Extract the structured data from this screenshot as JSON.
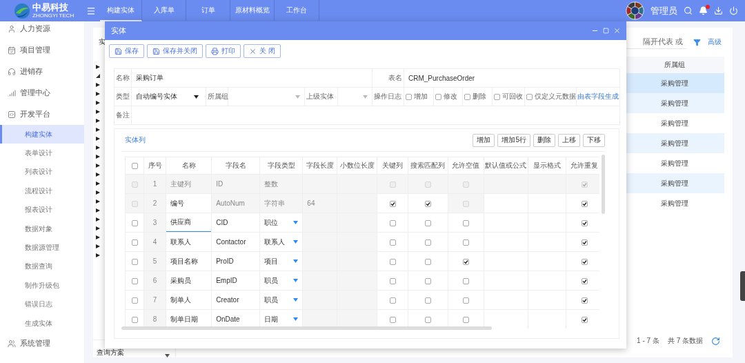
{
  "header": {
    "logo_title": "中易科技",
    "logo_subtitle": "ZHONGYI TECH",
    "tabs": [
      {
        "label": "构建实体",
        "selected": true
      },
      {
        "label": "入库单",
        "selected": false
      },
      {
        "label": "订单",
        "selected": false
      },
      {
        "label": "原材料概览",
        "selected": false
      },
      {
        "label": "工作台",
        "selected": false
      }
    ],
    "user": "管理员",
    "notification": true
  },
  "sidebar": {
    "items": [
      {
        "label": "人力资源"
      },
      {
        "label": "项目管理"
      },
      {
        "label": "进销存"
      },
      {
        "label": "管理中心"
      },
      {
        "label": "开发平台",
        "children": [
          {
            "label": "构建实体",
            "selected": true
          },
          {
            "label": "表单设计",
            "selected": false
          },
          {
            "label": "列表设计",
            "selected": false
          },
          {
            "label": "流程设计",
            "selected": false
          },
          {
            "label": "报表设计",
            "selected": false
          },
          {
            "label": "数据对象",
            "selected": false
          },
          {
            "label": "数据源管理",
            "selected": false
          },
          {
            "label": "数据查询",
            "selected": false
          },
          {
            "label": "制作升级包",
            "selected": false
          },
          {
            "label": "错误日志",
            "selected": false
          },
          {
            "label": "生成实体",
            "selected": false
          }
        ]
      },
      {
        "label": "系统管理"
      }
    ]
  },
  "background": {
    "panel_title": "实",
    "tree": [
      false,
      true,
      false,
      false,
      false,
      false,
      false,
      false,
      false,
      false,
      false,
      false,
      false,
      false,
      false,
      false,
      false,
      false,
      false,
      false,
      false,
      false
    ],
    "scheme": "查询方案",
    "search_text": "隔开代表 或",
    "advanced": "高级",
    "list_header": "所属组",
    "rows": [
      {
        "group": "采购管理",
        "selected": true
      },
      {
        "group": "采购管理",
        "selected": false
      },
      {
        "group": "采购管理",
        "selected": false
      },
      {
        "group": "采购管理",
        "selected": false
      },
      {
        "group": "采购管理",
        "selected": false
      },
      {
        "group": "采购管理",
        "selected": false
      },
      {
        "group": "采购管理",
        "selected": false
      }
    ],
    "range": "1 - 7 条",
    "total": "共 7 条数据"
  },
  "dialog": {
    "title": "实体",
    "toolbar": [
      {
        "kind": "save",
        "label": "保存"
      },
      {
        "kind": "save",
        "label": "保存并关闭"
      },
      {
        "kind": "print",
        "label": "打印"
      },
      {
        "kind": "close",
        "label": "关 闭"
      }
    ],
    "form": {
      "name_label": "名称",
      "name": "采购订单",
      "table_label": "表名",
      "table": "CRM_PurchaseOrder",
      "type_label": "类型",
      "type": "自动编号实体",
      "group_label": "所属组",
      "parent_label": "上级实体",
      "log_label": "操作日志",
      "log_options": [
        {
          "label": "增加",
          "checked": false
        },
        {
          "label": "修改",
          "checked": false
        },
        {
          "label": "删除",
          "checked": false
        },
        {
          "label": "可回收",
          "checked": false
        },
        {
          "label": "仅定义元数据",
          "checked": false
        }
      ],
      "generate_link": "由表字段生成",
      "remark_label": "备注"
    },
    "columns_title": "实体列",
    "column_actions": [
      "增加",
      "增加5行",
      "删除",
      "上移",
      "下移"
    ],
    "grid_header": [
      "序号",
      "名称",
      "字段名",
      "字段类型",
      "字段长度",
      "小数位长度",
      "关键列",
      "搜索匹配列",
      "允许空值",
      "默认值或公式",
      "显示格式",
      "允许重复"
    ],
    "grid_select_all": false,
    "rows": [
      {
        "index": "1",
        "name": "主键列",
        "field": "ID",
        "type": "整数",
        "locked": true,
        "fixed": true,
        "dropdown": false,
        "editing": false,
        "select": {
          "checked": false,
          "disabled": true
        },
        "key": {
          "checked": false,
          "disabled": true
        },
        "search": {
          "checked": false,
          "disabled": true
        },
        "nullable": {
          "checked": false,
          "disabled": true
        },
        "repeat": {
          "checked": true,
          "disabled": true
        }
      },
      {
        "index": "2",
        "name": "编号",
        "field": "AutoNum",
        "type": "字符串",
        "length": "64",
        "locked": false,
        "fixed": true,
        "dropdown": false,
        "editing": false,
        "select": {
          "checked": false,
          "disabled": true
        },
        "key": {
          "checked": true,
          "disabled": false
        },
        "search": {
          "checked": true,
          "disabled": false
        },
        "nullable": {
          "checked": false,
          "disabled": true
        },
        "repeat": {
          "checked": true,
          "disabled": false
        }
      },
      {
        "index": "3",
        "name": "供应商",
        "field": "CID",
        "type": "职位",
        "locked": false,
        "fixed": false,
        "dropdown": true,
        "editing": true,
        "select": {
          "checked": false,
          "disabled": false
        },
        "key": {
          "checked": false,
          "disabled": false
        },
        "search": {
          "checked": false,
          "disabled": false
        },
        "nullable": {
          "checked": false,
          "disabled": false
        },
        "repeat": {
          "checked": true,
          "disabled": false
        }
      },
      {
        "index": "4",
        "name": "联系人",
        "field": "Contactor",
        "type": "联系人",
        "locked": false,
        "fixed": false,
        "dropdown": true,
        "editing": false,
        "select": {
          "checked": false,
          "disabled": false
        },
        "key": {
          "checked": false,
          "disabled": false
        },
        "search": {
          "checked": false,
          "disabled": false
        },
        "nullable": {
          "checked": false,
          "disabled": false
        },
        "repeat": {
          "checked": true,
          "disabled": false
        }
      },
      {
        "index": "5",
        "name": "项目名称",
        "field": "ProID",
        "type": "项目",
        "locked": false,
        "fixed": false,
        "dropdown": true,
        "editing": false,
        "select": {
          "checked": false,
          "disabled": false
        },
        "key": {
          "checked": false,
          "disabled": false
        },
        "search": {
          "checked": false,
          "disabled": false
        },
        "nullable": {
          "checked": true,
          "disabled": false
        },
        "repeat": {
          "checked": true,
          "disabled": false
        }
      },
      {
        "index": "6",
        "name": "采购员",
        "field": "EmpID",
        "type": "职员",
        "locked": false,
        "fixed": false,
        "dropdown": true,
        "editing": false,
        "select": {
          "checked": false,
          "disabled": false
        },
        "key": {
          "checked": false,
          "disabled": false
        },
        "search": {
          "checked": false,
          "disabled": false
        },
        "nullable": {
          "checked": false,
          "disabled": false
        },
        "repeat": {
          "checked": true,
          "disabled": false
        }
      },
      {
        "index": "7",
        "name": "制单人",
        "field": "Creator",
        "type": "职员",
        "locked": false,
        "fixed": false,
        "dropdown": true,
        "editing": false,
        "select": {
          "checked": false,
          "disabled": false
        },
        "key": {
          "checked": false,
          "disabled": false
        },
        "search": {
          "checked": false,
          "disabled": false
        },
        "nullable": {
          "checked": false,
          "disabled": false
        },
        "repeat": {
          "checked": true,
          "disabled": false
        }
      },
      {
        "index": "8",
        "name": "制单日期",
        "field": "OnDate",
        "type": "日期",
        "locked": false,
        "fixed": false,
        "dropdown": true,
        "editing": false,
        "select": {
          "checked": false,
          "disabled": false
        },
        "key": {
          "checked": false,
          "disabled": false
        },
        "search": {
          "checked": false,
          "disabled": false
        },
        "nullable": {
          "checked": false,
          "disabled": false
        },
        "repeat": {
          "checked": true,
          "disabled": false
        }
      }
    ]
  }
}
